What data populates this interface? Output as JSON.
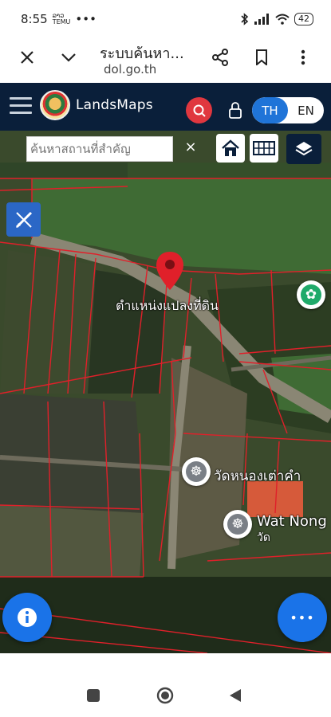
{
  "status_bar": {
    "time": "8:55",
    "small_text": "ລາວ\nTEMU",
    "dots": "•••",
    "battery": "42"
  },
  "browser": {
    "title": "ระบบค้นหา...",
    "url": "dol.go.th"
  },
  "app": {
    "name": "LandsMaps",
    "lang_th": "TH",
    "lang_en": "EN"
  },
  "map": {
    "search_placeholder": "ค้นหาสถานที่สำคัญ",
    "clear": "×",
    "marker_label": "ตำแหน่งแปลงที่ดิน",
    "temple_label_1": "วัดหนองเต่าคำ",
    "temple_label_2": "Wat Nong",
    "temple_label_3": "วัด",
    "fab_more": "•••"
  }
}
